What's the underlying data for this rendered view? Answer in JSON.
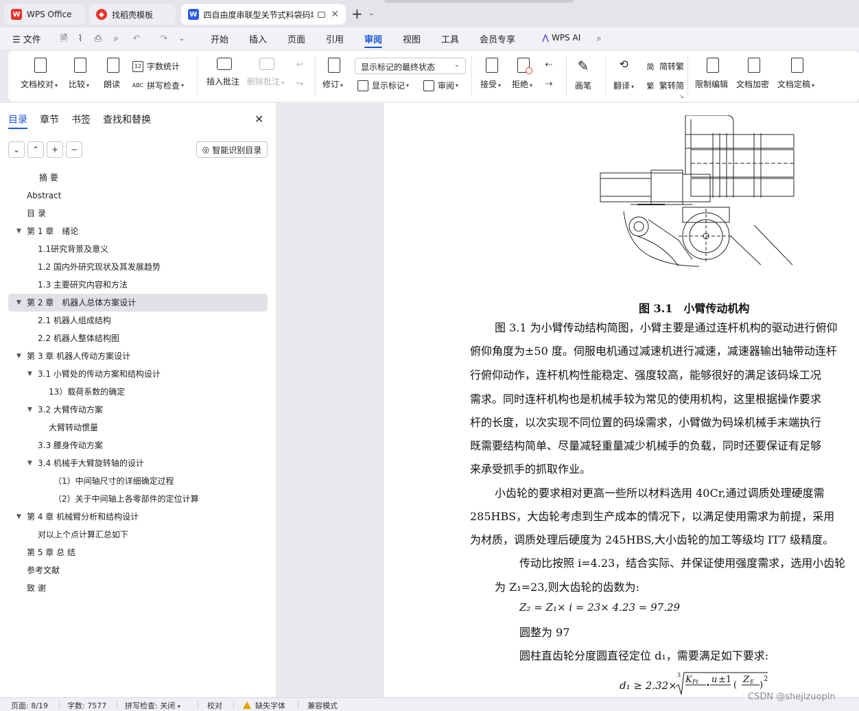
{
  "tabs": [
    {
      "label": "WPS Office"
    },
    {
      "label": "找稻壳模板"
    },
    {
      "label": "四自由度串联型关节式料袋码垛"
    }
  ],
  "menu": {
    "file": "文件",
    "items": [
      "开始",
      "插入",
      "页面",
      "引用",
      "审阅",
      "视图",
      "工具",
      "会员专享"
    ],
    "active": "审阅",
    "wps_ai": "WPS AI"
  },
  "ribbon": {
    "doc_check": "文档校对",
    "compare": "比较",
    "read_aloud": "朗读",
    "word_count": "字数统计",
    "spell_check": "拼写检查",
    "insert_comment": "插入批注",
    "delete_comment": "删除批注",
    "track_changes": "修订",
    "markup_state": "显示标记的最终状态",
    "show_markup": "显示标记",
    "review": "审阅",
    "accept": "接受",
    "reject": "拒绝",
    "pen": "画笔",
    "translate": "翻译",
    "to_traditional": "简转繁",
    "to_simplified": "繁转简",
    "restrict_edit": "限制编辑",
    "encrypt": "文档加密",
    "finalize": "文档定稿"
  },
  "nav": {
    "tabs": [
      "目录",
      "章节",
      "书签",
      "查找和替换"
    ],
    "smart_toc": "智能识别目录",
    "toc": [
      {
        "label": "摘 要",
        "level": 1,
        "arrow": false
      },
      {
        "label": "Abstract",
        "level": 0,
        "arrow": false
      },
      {
        "label": "目 录",
        "level": 0,
        "arrow": false
      },
      {
        "label": "第 1 章　绪论",
        "level": 0,
        "arrow": true
      },
      {
        "label": "1.1研究背景及意义",
        "level": 1,
        "arrow": false
      },
      {
        "label": "1.2  国内外研究现状及其发展趋势",
        "level": 1,
        "arrow": false
      },
      {
        "label": "1.3  主要研究内容和方法",
        "level": 1,
        "arrow": false
      },
      {
        "label": "第 2 章　机器人总体方案设计",
        "level": 0,
        "arrow": true,
        "selected": true
      },
      {
        "label": "2.1 机器人组成结构",
        "level": 1,
        "arrow": false
      },
      {
        "label": "2.2 机器人整体结构图",
        "level": 1,
        "arrow": false
      },
      {
        "label": "第 3 章  机器人传动方案设计",
        "level": 0,
        "arrow": true
      },
      {
        "label": "3.1 小臂处的传动方案和结构设计",
        "level": 1,
        "arrow": true
      },
      {
        "label": "13）载荷系数的确定",
        "level": 2,
        "arrow": false
      },
      {
        "label": "3.2 大臂传动方案",
        "level": 1,
        "arrow": true
      },
      {
        "label": "大臂转动惯量",
        "level": 2,
        "arrow": false
      },
      {
        "label": "3.3 腰身传动方案",
        "level": 1,
        "arrow": false
      },
      {
        "label": "3.4 机械手大臂旋转轴的设计",
        "level": 1,
        "arrow": true
      },
      {
        "label": "（1）中间轴尺寸的详细确定过程",
        "level": 3,
        "arrow": false
      },
      {
        "label": "（2）关于中间轴上各零部件的定位计算",
        "level": 3,
        "arrow": false
      },
      {
        "label": "第 4 章  机械臂分析和结构设计",
        "level": 0,
        "arrow": true
      },
      {
        "label": "对以上个点计算汇总如下",
        "level": 1,
        "arrow": false
      },
      {
        "label": "第 5 章  总  结",
        "level": 0,
        "arrow": false
      },
      {
        "label": "参考文献",
        "level": 0,
        "arrow": false
      },
      {
        "label": "致  谢",
        "level": 0,
        "arrow": false
      }
    ]
  },
  "doc": {
    "caption": "图 3.1　小臂传动机构",
    "lines": [
      "图 3.1 为小臂传动结构简图，小臂主要是通过连杆机构的驱动进行俯仰",
      "俯仰角度为±50 度。伺服电机通过减速机进行减速，减速器输出轴带动连杆",
      "行俯仰动作，连杆机构性能稳定、强度较高，能够很好的满足该码垛工况",
      "需求。同时连杆机构也是机械手较为常见的使用机构，这里根据操作要求",
      "杆的长度，以次实现不同位置的码垛需求，小臂做为码垛机械手末端执行",
      "既需要结构简单、尽量减轻重量减少机械手的负载，同时还要保证有足够",
      "来承受抓手的抓取作业。",
      "小齿轮的要求相对更高一些所以材料选用 40Cr,通过调质处理硬度需",
      "285HBS，大齿轮考虑到生产成本的情况下，以满足使用需求为前提，采用",
      "为材质，调质处理后硬度为 245HBS,大小齿轮的加工等级均 IT7 级精度。",
      "传动比按照 i=4.23，结合实际、并保证使用强度需求，选用小齿轮",
      "为 Z₁=23,则大齿轮的齿数为:",
      "Z₂ = Z₁× i = 23× 4.23 = 97.29",
      "圆整为 97",
      "圆柱直齿轮分度圆直径定位 d₁，需要满足如下要求:",
      "d₁ ≥ 2.32×"
    ]
  },
  "status": {
    "page": "页面: 8/19",
    "words": "字数: 7577",
    "spell": "拼写检查: 关闭",
    "proof": "校对",
    "missing_font": "缺失字体",
    "compat": "兼容模式"
  },
  "watermark": "CSDN @shejizuopin",
  "colors": {
    "accent": "#1a56d6",
    "wps_red": "#e8322b",
    "doc_blue": "#2b5ce6"
  }
}
